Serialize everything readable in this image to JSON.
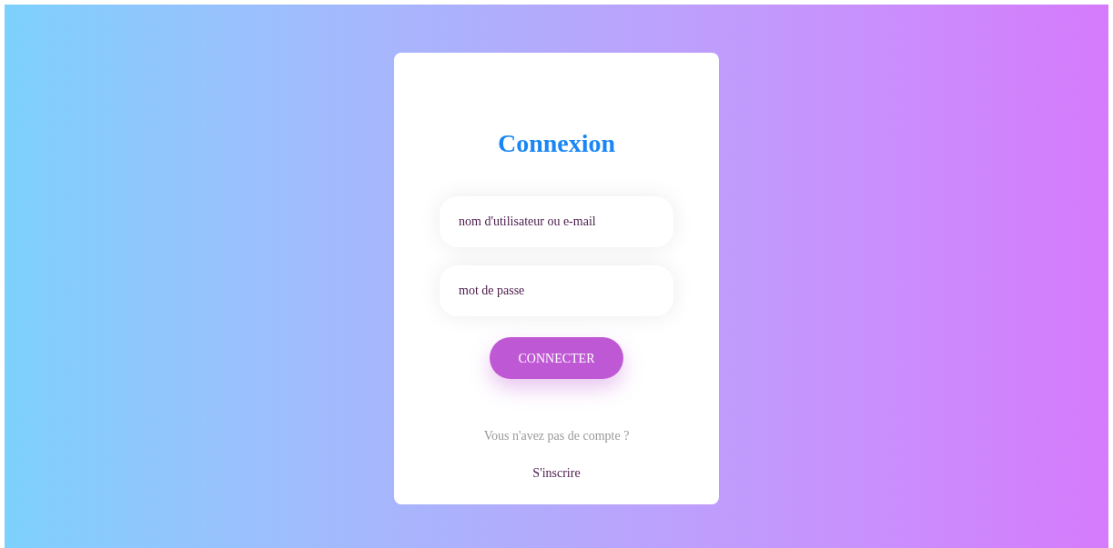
{
  "title": "Connexion",
  "fields": [
    {
      "placeholder": "nom d'utilisateur ou e-mail"
    },
    {
      "placeholder": "mot de passe"
    }
  ],
  "button": "CONNECTER",
  "signup_prompt": "Vous n'avez pas de compte ?",
  "signup_link": "S'inscrire"
}
